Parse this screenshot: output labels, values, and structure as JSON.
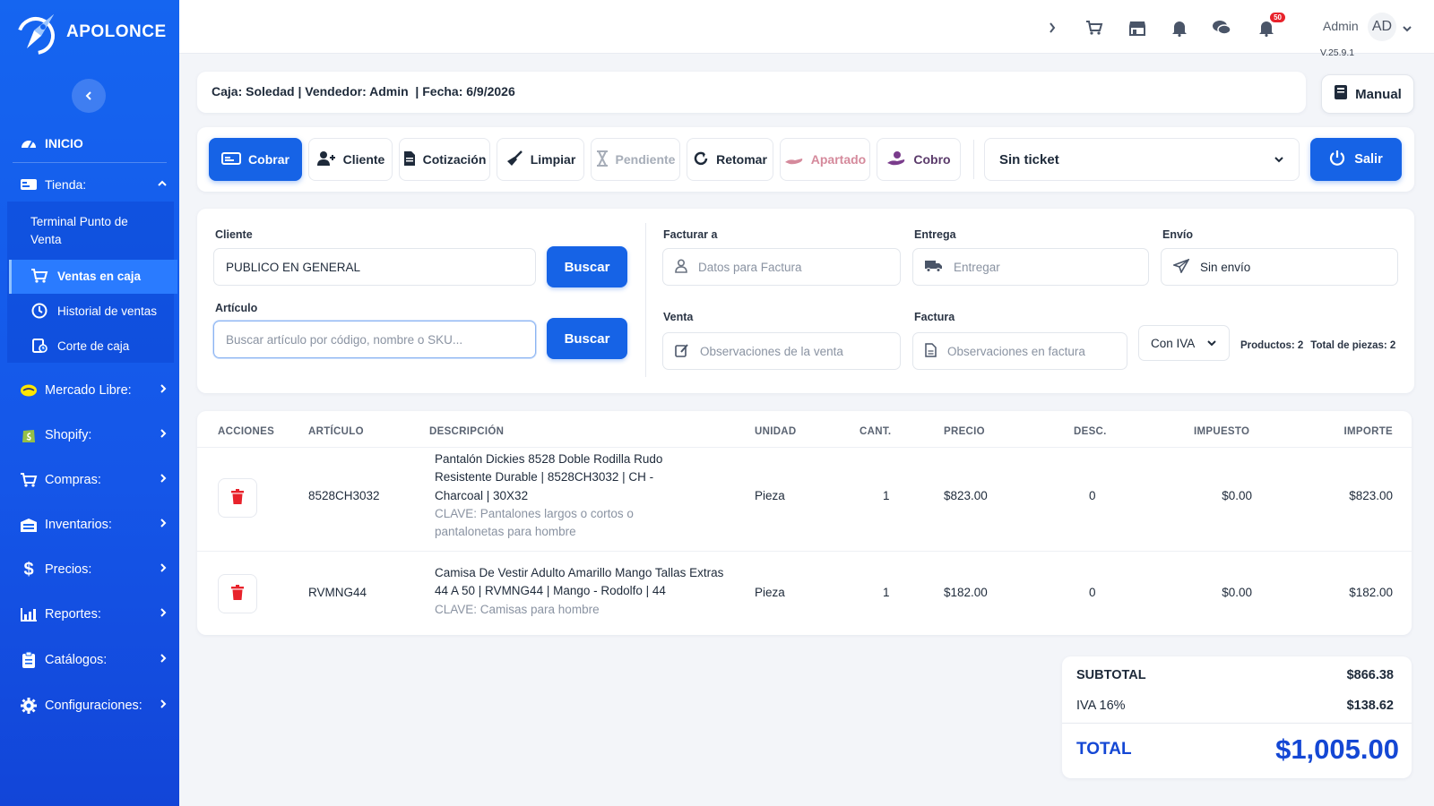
{
  "sidebar": {
    "logo_text": "APOLONCE",
    "home_label": "INICIO",
    "tienda_label": "Tienda:",
    "tienda_items": [
      {
        "label": "Terminal Punto de Venta"
      },
      {
        "label": "Ventas en caja"
      },
      {
        "label": "Historial de ventas"
      },
      {
        "label": "Corte de caja"
      }
    ],
    "nav": [
      {
        "label": "Mercado Libre:",
        "icon": "mercadolibre-icon"
      },
      {
        "label": "Shopify:",
        "icon": "shopify-icon"
      },
      {
        "label": "Compras:",
        "icon": "cart-icon"
      },
      {
        "label": "Inventarios:",
        "icon": "warehouse-icon"
      },
      {
        "label": "Precios:",
        "icon": "dollar-icon"
      },
      {
        "label": "Reportes:",
        "icon": "chart-icon"
      },
      {
        "label": "Catálogos:",
        "icon": "clipboard-icon"
      },
      {
        "label": "Configuraciones:",
        "icon": "gear-icon"
      }
    ]
  },
  "topbar": {
    "notification_count": "50",
    "user_name": "Admin",
    "avatar_initials": "AD",
    "version": "V.25.9.1"
  },
  "infobar": {
    "text": "Caja: Soledad | Vendedor: Admin  | Fecha: 6/9/2026",
    "manual_label": "Manual"
  },
  "toolbar": {
    "cobrar": "Cobrar",
    "cliente": "Cliente",
    "cotizacion": "Cotización",
    "limpiar": "Limpiar",
    "pendiente": "Pendiente",
    "retomar": "Retomar",
    "apartado": "Apartado",
    "cobro": "Cobro",
    "ticket_select": "Sin ticket",
    "salir": "Salir"
  },
  "form": {
    "cliente_label": "Cliente",
    "cliente_value": "PUBLICO EN GENERAL",
    "buscar_label": "Buscar",
    "articulo_label": "Artículo",
    "articulo_placeholder": "Buscar artículo por código, nombre o SKU...",
    "facturar_label": "Facturar a",
    "facturar_placeholder": "Datos para Factura",
    "entrega_label": "Entrega",
    "entrega_placeholder": "Entregar",
    "envio_label": "Envío",
    "envio_value": "Sin envío",
    "venta_label": "Venta",
    "venta_placeholder": "Observaciones de la venta",
    "factura_label": "Factura",
    "factura_placeholder": "Observaciones en factura",
    "iva_select": "Con IVA",
    "productos": "Productos: 2",
    "piezas": "Total de piezas: 2"
  },
  "table": {
    "headers": {
      "acciones": "ACCIONES",
      "articulo": "ARTÍCULO",
      "descripcion": "DESCRIPCIÓN",
      "unidad": "UNIDAD",
      "cant": "CANT.",
      "precio": "PRECIO",
      "desc": "DESC.",
      "impuesto": "IMPUESTO",
      "importe": "IMPORTE"
    },
    "rows": [
      {
        "articulo": "8528CH3032",
        "descripcion": "Pantalón Dickies 8528 Doble Rodilla Rudo Resistente Durable | 8528CH3032 | CH - Charcoal | 30X32",
        "clave": "CLAVE: Pantalones largos o cortos o pantalonetas para hombre",
        "unidad": "Pieza",
        "cant": "1",
        "precio": "$823.00",
        "desc": "0",
        "impuesto": "$0.00",
        "importe": "$823.00"
      },
      {
        "articulo": "RVMNG44",
        "descripcion": "Camisa De Vestir Adulto Amarillo Mango Tallas Extras 44 A 50 | RVMNG44 | Mango - Rodolfo | 44",
        "clave": "CLAVE: Camisas para hombre",
        "unidad": "Pieza",
        "cant": "1",
        "precio": "$182.00",
        "desc": "0",
        "impuesto": "$0.00",
        "importe": "$182.00"
      }
    ]
  },
  "totals": {
    "subtotal_label": "SUBTOTAL",
    "subtotal": "$866.38",
    "iva_label": "IVA 16%",
    "iva": "$138.62",
    "total_label": "TOTAL",
    "total": "$1,005.00"
  },
  "colors": {
    "sidebar": "#1565f0",
    "primary": "#1663e6",
    "total": "#1447d4",
    "danger": "#e8222b"
  }
}
